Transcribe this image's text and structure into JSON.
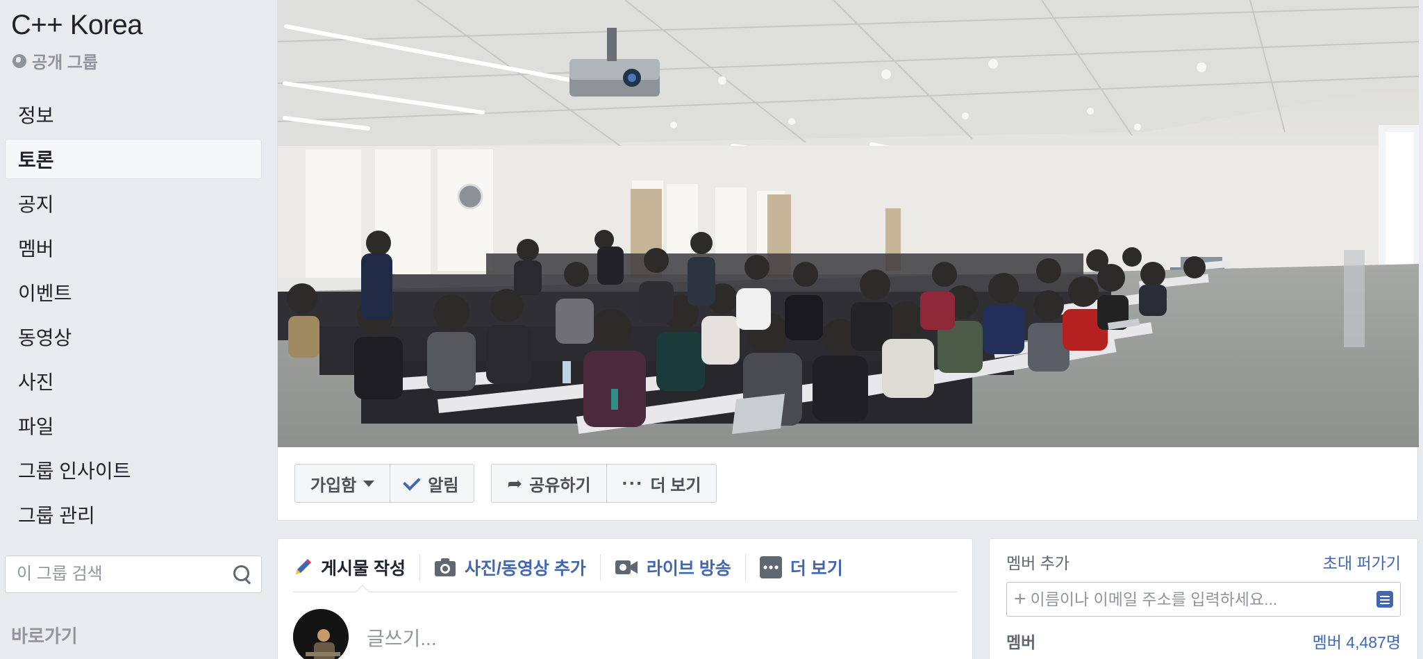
{
  "group": {
    "name": "C++ Korea",
    "privacy": "공개 그룹"
  },
  "sidebar": {
    "items": [
      {
        "label": "정보"
      },
      {
        "label": "토론",
        "active": true
      },
      {
        "label": "공지"
      },
      {
        "label": "멤버"
      },
      {
        "label": "이벤트"
      },
      {
        "label": "동영상"
      },
      {
        "label": "사진"
      },
      {
        "label": "파일"
      },
      {
        "label": "그룹 인사이트"
      },
      {
        "label": "그룹 관리"
      }
    ],
    "search_placeholder": "이 그룹 검색",
    "shortcuts_title": "바로가기"
  },
  "actions": {
    "joined": "가입함",
    "notify": "알림",
    "share": "공유하기",
    "more": "더 보기"
  },
  "composer": {
    "tabs": [
      {
        "label": "게시물 작성",
        "icon": "pencil-icon"
      },
      {
        "label": "사진/동영상 추가",
        "icon": "camera-icon"
      },
      {
        "label": "라이브 방송",
        "icon": "video-camera-icon"
      },
      {
        "label": "더 보기",
        "icon": "more-dots-icon"
      }
    ],
    "placeholder": "글쓰기..."
  },
  "members": {
    "add_label": "멤버 추가",
    "invite_link": "초대 퍼가기",
    "input_placeholder": "이름이나 이메일 주소를 입력하세요...",
    "members_label": "멤버",
    "count_link": "멤버 4,487명"
  },
  "colors": {
    "background": "#e9ebee",
    "link": "#4267b2",
    "text": "#1d2129",
    "muted": "#90949c"
  }
}
